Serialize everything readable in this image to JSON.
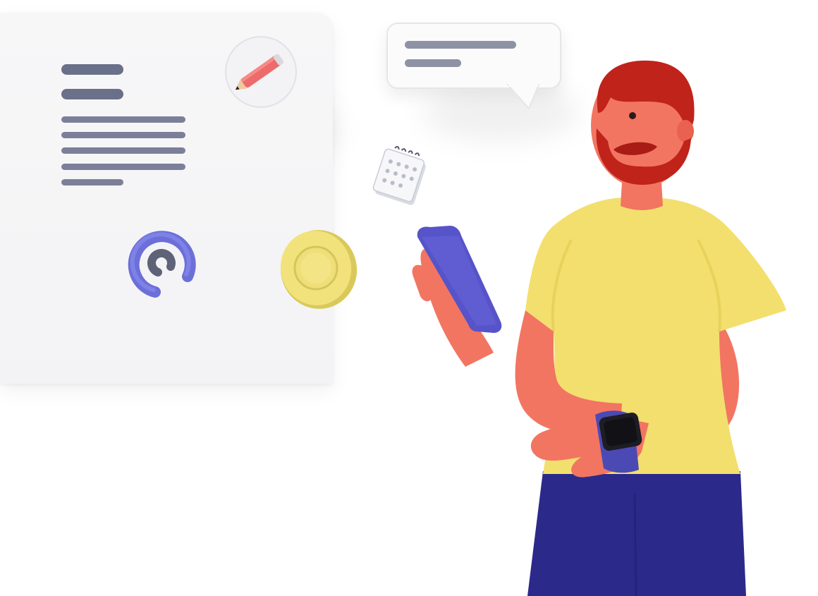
{
  "scene": {
    "colors": {
      "document_card": "#f5f5f7",
      "text_lines": "#737791",
      "pencil_body": "#ee6b6b",
      "at_symbol": "#6c6fd8",
      "coin": "#f1e27c",
      "shirt": "#f3df6e",
      "skin": "#f27562",
      "beard": "#c0231a",
      "pants": "#2b2a8a",
      "phone": "#5753c9",
      "watch_strap": "#4b4ab4"
    },
    "icons": [
      "pencil-icon",
      "at-sign-icon",
      "coin-icon",
      "calendar-icon",
      "chat-bubble-icon",
      "smartwatch-icon",
      "smartphone-icon"
    ]
  }
}
